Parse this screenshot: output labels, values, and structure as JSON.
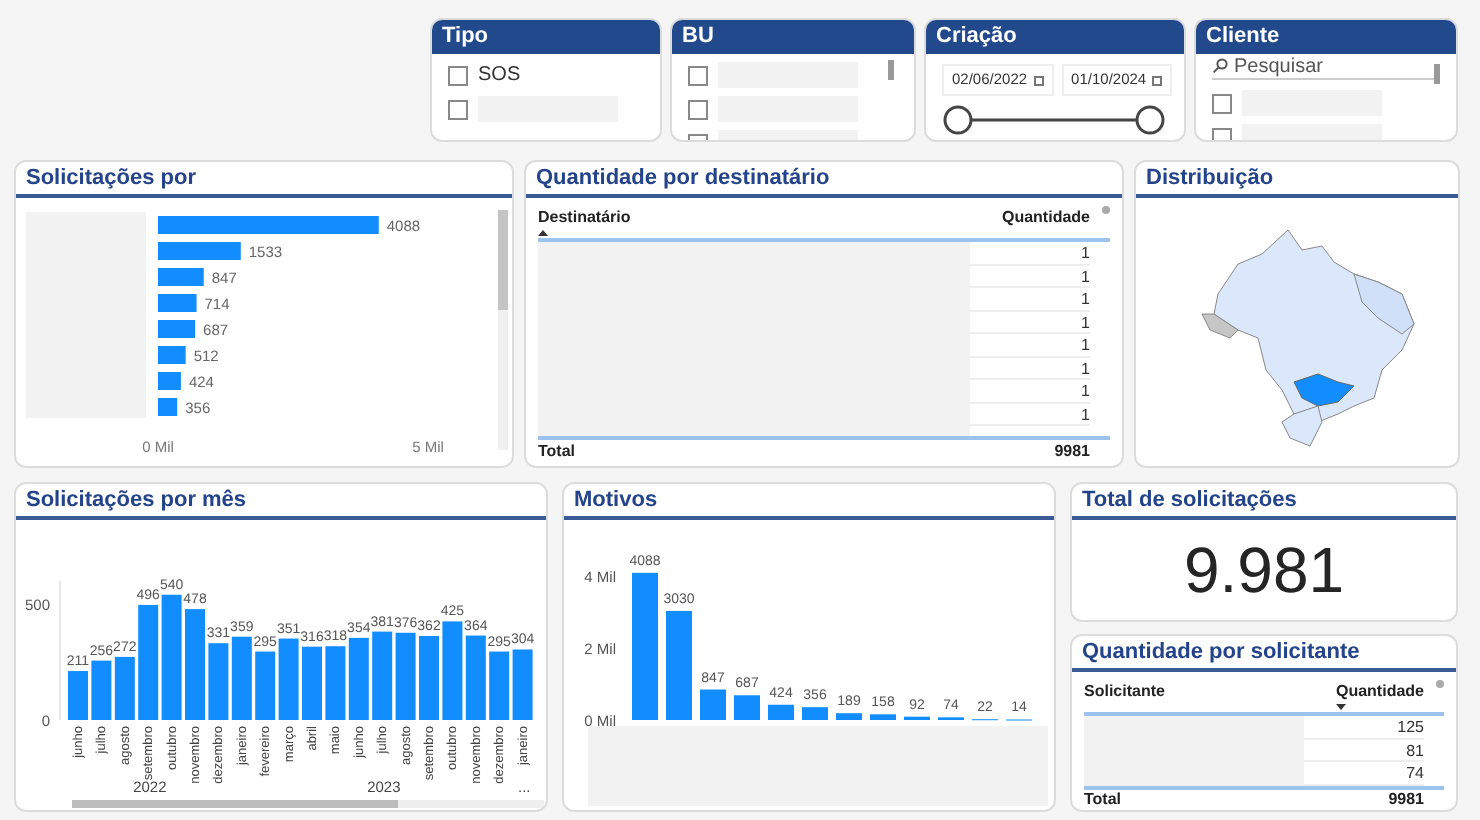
{
  "slicers": [
    {
      "kind": "checklist",
      "title": "Tipo",
      "items": [
        {
          "label": "SOS",
          "checked": false
        },
        {
          "checked": false
        }
      ]
    },
    {
      "kind": "checklist",
      "title": "BU",
      "scroll": true,
      "items": [
        {
          "checked": false
        },
        {
          "checked": false
        },
        {
          "checked": false
        }
      ]
    },
    {
      "kind": "date_range",
      "title": "Criação",
      "start": "02/06/2022",
      "end": "01/10/2024",
      "thumbs": [
        {
          "level": 0
        },
        {
          "level": 1
        }
      ]
    },
    {
      "kind": "search_list",
      "title": "Cliente",
      "placeholder": "Pesquisar",
      "items": [
        {
          "checked": false
        },
        {
          "checked": false
        }
      ]
    }
  ],
  "requests_by": {
    "title": "Solicitações por",
    "bar_labels": [
      "4088",
      "1533",
      "847",
      "714",
      "687",
      "512",
      "424",
      "356"
    ],
    "axis_labels": [
      "0 Mil",
      "5 Mil"
    ]
  },
  "recipients": {
    "title": "Quantidade por destinatário",
    "columns": [
      "Destinatário",
      "Quantidade"
    ],
    "rows": [
      "1",
      "1",
      "1",
      "1",
      "1",
      "1",
      "1",
      "1"
    ],
    "total_label": "Total",
    "total": "9981"
  },
  "distribution": {
    "title": "Distribuição"
  },
  "by_month": {
    "title": "Solicitações por mês",
    "year_labels": [
      "2022",
      "2023",
      "..."
    ],
    "chart_data": {
      "type": "bar",
      "categories": [
        "junho",
        "julho",
        "agosto",
        "setembro",
        "outubro",
        "novembro",
        "dezembro",
        "janeiro",
        "fevereiro",
        "março",
        "abril",
        "maio",
        "junho",
        "julho",
        "agosto",
        "setembro",
        "outubro",
        "novembro",
        "dezembro",
        "janeiro"
      ],
      "values": [
        211,
        256,
        272,
        496,
        540,
        478,
        331,
        359,
        295,
        351,
        316,
        318,
        354,
        381,
        376,
        362,
        425,
        364,
        295,
        304
      ],
      "ylim": [
        0,
        600
      ],
      "yticks": [
        0,
        500
      ],
      "data_labels": true
    }
  },
  "reasons": {
    "title": "Motivos",
    "bar_labels": [
      "4088",
      "3030",
      "847",
      "687",
      "424",
      "356",
      "189",
      "158",
      "92",
      "74",
      "22",
      "14"
    ],
    "axis_labels": [
      "4 Mil",
      "2 Mil",
      "0 Mil"
    ]
  },
  "total": {
    "title": "Total de solicitações",
    "value": "9.981"
  },
  "requesters": {
    "title": "Quantidade por solicitante",
    "columns": [
      "Solicitante",
      "Quantidade"
    ],
    "rows": [
      "125",
      "81",
      "74"
    ],
    "total_label": "Total",
    "total": "9981"
  }
}
